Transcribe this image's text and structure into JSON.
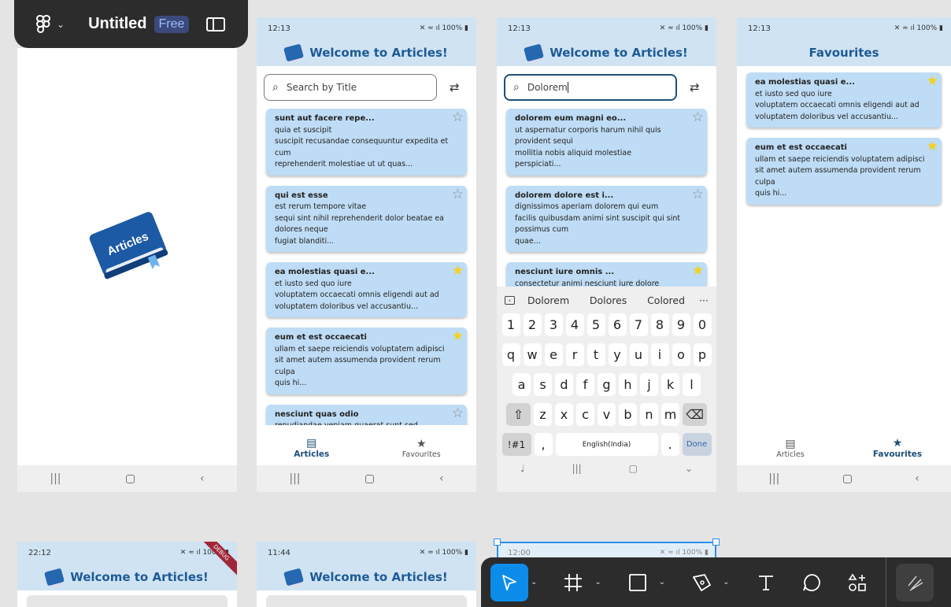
{
  "figma": {
    "title": "Untitled",
    "plan_badge": "Free"
  },
  "phones": {
    "splash": {
      "logo_text": "Articles"
    },
    "home": {
      "time": "12:13",
      "status_right": "100%",
      "title": "Welcome to Articles!",
      "search_placeholder": "Search by Title",
      "cards": [
        {
          "title": "sunt aut facere repe...",
          "body": "quia et suscipit\nsuscipit recusandae consequuntur expedita et cum\nreprehenderit molestiae ut ut quas...",
          "fav": false
        },
        {
          "title": "qui est esse",
          "body": "est rerum tempore vitae\nsequi sint nihil reprehenderit dolor beatae ea dolores neque\nfugiat blanditi...",
          "fav": false
        },
        {
          "title": "ea molestias quasi e...",
          "body": "et iusto sed quo iure\nvoluptatem occaecati omnis eligendi aut ad\nvoluptatem doloribus vel accusantiu...",
          "fav": true
        },
        {
          "title": "eum et est occaecati",
          "body": "ullam et saepe reiciendis voluptatem adipisci\nsit amet autem assumenda provident rerum culpa\nquis hi...",
          "fav": true
        },
        {
          "title": "nesciunt quas odio",
          "body": "repudiandae veniam quaerat sunt sed",
          "fav": false
        }
      ],
      "nav": [
        {
          "label": "Articles",
          "icon": "article-icon",
          "selected": true
        },
        {
          "label": "Favourites",
          "icon": "star-icon",
          "selected": false
        }
      ]
    },
    "search": {
      "time": "12:13",
      "status_right": "100%",
      "title": "Welcome to Articles!",
      "search_value": "Dolorem",
      "cards": [
        {
          "title": "dolorem eum magni eo...",
          "body": "ut aspernatur corporis harum nihil quis provident sequi\nmollitia nobis aliquid molestiae\nperspiciati...",
          "fav": false
        },
        {
          "title": "dolorem dolore est i...",
          "body": "dignissimos aperiam dolorem qui eum\nfacilis quibusdam animi sint suscipit qui sint possimus cum\nquae...",
          "fav": false
        },
        {
          "title": "nesciunt iure omnis ...",
          "body": "consectetur animi nesciunt iure dolore",
          "fav": true
        }
      ],
      "keyboard": {
        "suggestions": [
          "Dolorem",
          "Dolores",
          "Colored"
        ],
        "more": "···",
        "row_numbers": [
          "1",
          "2",
          "3",
          "4",
          "5",
          "6",
          "7",
          "8",
          "9",
          "0"
        ],
        "row1": [
          "q",
          "w",
          "e",
          "r",
          "t",
          "y",
          "u",
          "i",
          "o",
          "p"
        ],
        "row2": [
          "a",
          "s",
          "d",
          "f",
          "g",
          "h",
          "j",
          "k",
          "l"
        ],
        "row3": [
          "z",
          "x",
          "c",
          "v",
          "b",
          "n",
          "m"
        ],
        "sym": "!#1",
        "comma": ",",
        "space": "English(India)",
        "period": ".",
        "done": "Done"
      }
    },
    "favourites": {
      "time": "12:13",
      "status_right": "100%",
      "title": "Favourites",
      "cards": [
        {
          "title": "ea molestias quasi e...",
          "body": "et iusto sed quo iure\nvoluptatem occaecati omnis eligendi aut ad\nvoluptatem doloribus vel accusantiu...",
          "fav": true
        },
        {
          "title": "eum et est occaecati",
          "body": "ullam et saepe reiciendis voluptatem adipisci\nsit amet autem assumenda provident rerum culpa\nquis hi...",
          "fav": true
        }
      ],
      "nav": [
        {
          "label": "Articles",
          "icon": "article-icon",
          "selected": false
        },
        {
          "label": "Favourites",
          "icon": "star-icon",
          "selected": true
        }
      ]
    },
    "bottom1": {
      "time": "22:12",
      "status_right": "100%",
      "title": "Welcome to Articles!",
      "ribbon": "DEBUG"
    },
    "bottom2": {
      "time": "11:44",
      "status_right": "100%",
      "title": "Welcome to Articles!"
    },
    "bottom3": {
      "time": "12:00",
      "status_right": "100%"
    }
  },
  "toolbar": {
    "tools": [
      "move-tool",
      "frame-tool",
      "shape-tool",
      "pen-tool",
      "text-tool",
      "comment-tool",
      "actions-tool"
    ],
    "active": "move-tool"
  },
  "colors": {
    "appbar": "#cfe3f2",
    "card": "#bedcf5",
    "title_blue": "#1e5a96",
    "star_on": "#f2d21b",
    "figma_dark": "#2c2c2c",
    "figma_blue": "#0c8ce9"
  }
}
